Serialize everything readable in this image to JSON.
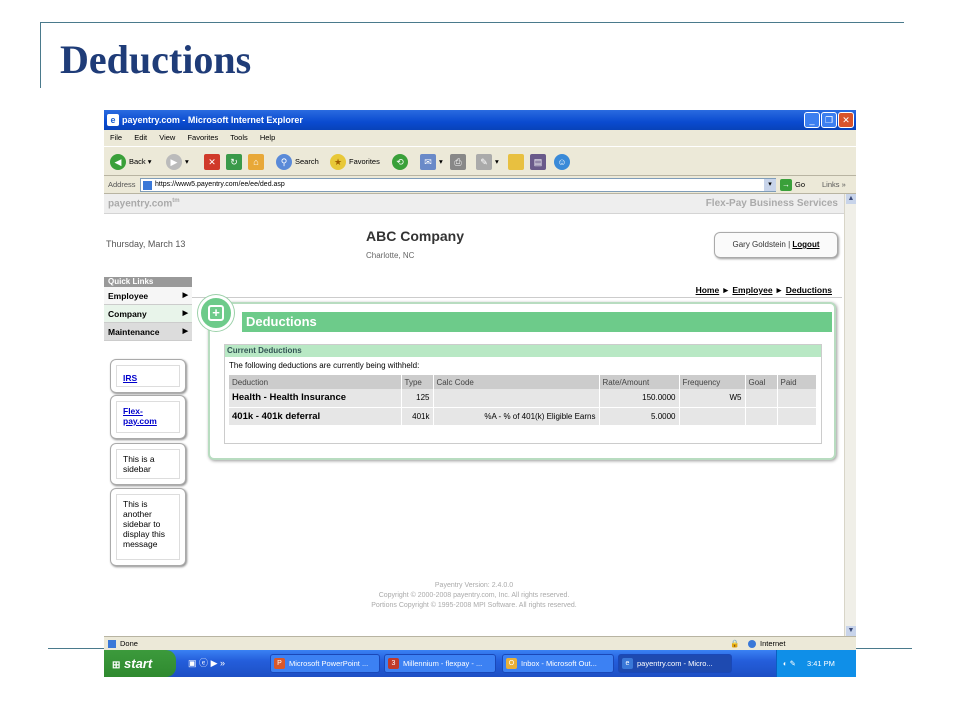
{
  "slide": {
    "title": "Deductions"
  },
  "window": {
    "title": "payentry.com - Microsoft Internet Explorer",
    "menu": [
      "File",
      "Edit",
      "View",
      "Favorites",
      "Tools",
      "Help"
    ],
    "toolbar": {
      "back": "Back",
      "search": "Search",
      "favorites": "Favorites"
    },
    "address_label": "Address",
    "url": "https://www5.payentry.com/ee/ee/ded.asp",
    "go": "Go",
    "links": "Links"
  },
  "page": {
    "brand": "payentry.com",
    "brand_tm": "tm",
    "service": "Flex-Pay Business Services",
    "date": "Thursday, March 13",
    "company": "ABC Company",
    "city": "Charlotte, NC",
    "user": "Gary Goldstein",
    "separator": "|",
    "logout": "Logout",
    "quick_links_title": "Quick Links",
    "quick_links": [
      "Employee",
      "Company",
      "Maintenance"
    ],
    "sidebars": {
      "irs": "IRS",
      "flexpay": "Flex-pay.com",
      "sidebar1": "This is a sidebar",
      "sidebar2": "This is another sidebar to display this message"
    },
    "breadcrumb": [
      "Home",
      "Employee",
      "Deductions"
    ],
    "breadcrumb_sep": "►",
    "panel_title": "Deductions",
    "section_title": "Current Deductions",
    "section_desc": "The following deductions are currently being withheld:",
    "table": {
      "headers": [
        "Deduction",
        "Type",
        "Calc Code",
        "Rate/Amount",
        "Frequency",
        "Goal",
        "Paid"
      ],
      "rows": [
        [
          "Health - Health Insurance",
          "125",
          "",
          "150.0000",
          "W5",
          "",
          ""
        ],
        [
          "401k - 401k deferral",
          "401k",
          "%A - % of 401(k) Eligible Earns",
          "5.0000",
          "",
          "",
          ""
        ]
      ]
    },
    "footer": [
      "Payentry Version: 2.4.0.0",
      "Copyright © 2000-2008 payentry.com, Inc. All rights reserved.",
      "Portions Copyright © 1995-2008 MPI Software. All rights reserved."
    ]
  },
  "status": {
    "text": "Done",
    "zone": "Internet"
  },
  "taskbar": {
    "start": "start",
    "buttons": [
      "Microsoft PowerPoint ...",
      "Millennium - flexpay - ...",
      "Inbox - Microsoft Out...",
      "payentry.com - Micro..."
    ],
    "time": "3:41 PM"
  },
  "colors": {
    "accent": "#6dcb8a",
    "title_blue": "#1f3c78"
  }
}
